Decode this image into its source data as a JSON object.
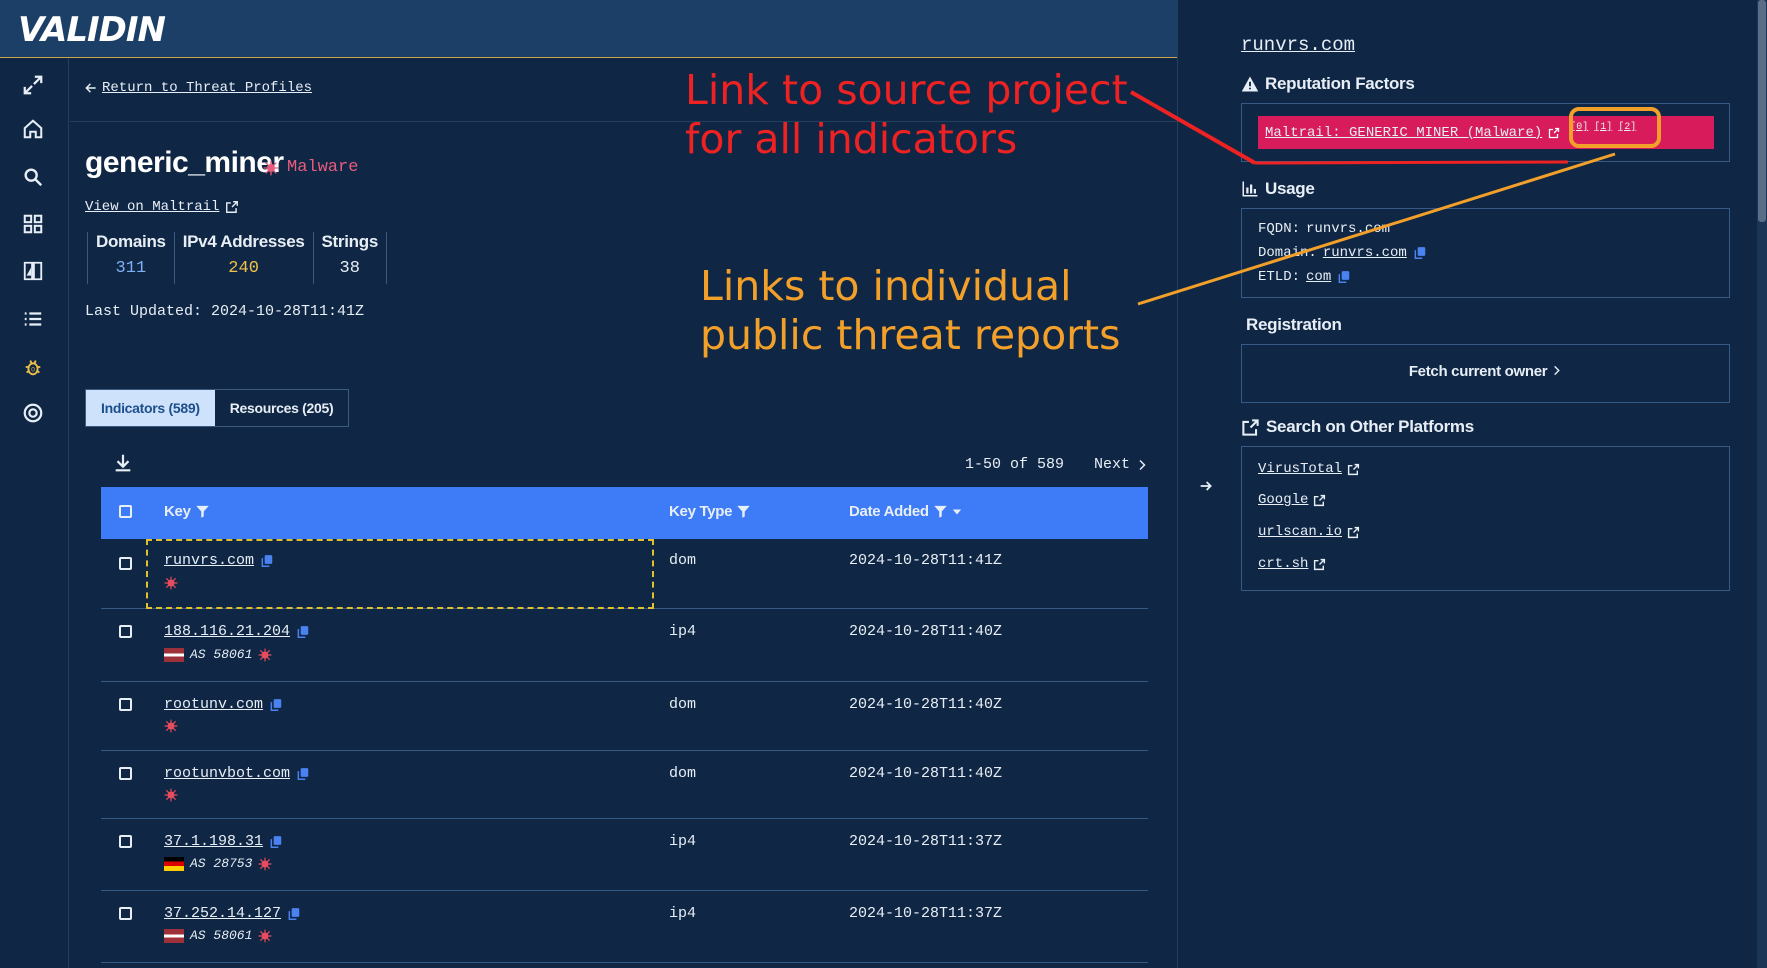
{
  "app": {
    "logo_text": "VALIDIN"
  },
  "colors": {
    "accent": "#3d7bf7",
    "malware": "#e85b7c",
    "reputation": "#d81b5a",
    "annotation_red": "#ee2222",
    "annotation_orange": "#f2a02a"
  },
  "nav": {
    "items": [
      "expand-icon",
      "home-icon",
      "search-icon",
      "grid-icon",
      "compare-icon",
      "list-icon",
      "bug-icon",
      "target-icon"
    ]
  },
  "main": {
    "return_label": "Return to Threat Profiles",
    "title": "generic_miner",
    "category": "Malware",
    "view_link": "View on Maltrail",
    "stats": [
      {
        "label": "Domains",
        "value": "311",
        "color": "#7eb0f5"
      },
      {
        "label": "IPv4 Addresses",
        "value": "240",
        "color": "#f0c24a"
      },
      {
        "label": "Strings",
        "value": "38",
        "color": "#e8eef6"
      }
    ],
    "last_updated": "Last Updated: 2024-10-28T11:41Z",
    "tabs": [
      "Indicators (589)",
      "Resources (205)"
    ],
    "pager": {
      "range": "1-50 of 589",
      "next": "Next"
    },
    "columns": [
      "Key",
      "Key Type",
      "Date Added"
    ],
    "rows": [
      {
        "key": "runvrs.com",
        "type": "dom",
        "date": "2024-10-28T11:41Z",
        "asn": "",
        "flag": ""
      },
      {
        "key": "188.116.21.204",
        "type": "ip4",
        "date": "2024-10-28T11:40Z",
        "asn": "AS 58061",
        "flag": "lv"
      },
      {
        "key": "rootunv.com",
        "type": "dom",
        "date": "2024-10-28T11:40Z",
        "asn": "",
        "flag": ""
      },
      {
        "key": "rootunvbot.com",
        "type": "dom",
        "date": "2024-10-28T11:40Z",
        "asn": "",
        "flag": ""
      },
      {
        "key": "37.1.198.31",
        "type": "ip4",
        "date": "2024-10-28T11:37Z",
        "asn": "AS 28753",
        "flag": "de"
      },
      {
        "key": "37.252.14.127",
        "type": "ip4",
        "date": "2024-10-28T11:37Z",
        "asn": "AS 58061",
        "flag": "lv"
      }
    ]
  },
  "panel": {
    "title": "runvrs.com",
    "reputation_heading": "Reputation Factors",
    "reputation_text": "Maltrail: GENERIC MINER (Malware)",
    "reputation_refs": [
      "[0]",
      "[1]",
      "[2]"
    ],
    "usage_heading": "Usage",
    "usage": {
      "fqdn_label": "FQDN:",
      "fqdn": "runvrs.com",
      "domain_label": "Domain:",
      "domain": "runvrs.com",
      "etld_label": "ETLD:",
      "etld": "com"
    },
    "registration_heading": "Registration",
    "fetch_label": "Fetch current owner",
    "search_heading": "Search on Other Platforms",
    "platforms": [
      "VirusTotal",
      "Google",
      "urlscan.io",
      "crt.sh"
    ]
  },
  "annotations": {
    "red_line1": "Link to source project",
    "red_line2": "for all indicators",
    "orange_line1": "Links to individual",
    "orange_line2": "public threat reports"
  }
}
